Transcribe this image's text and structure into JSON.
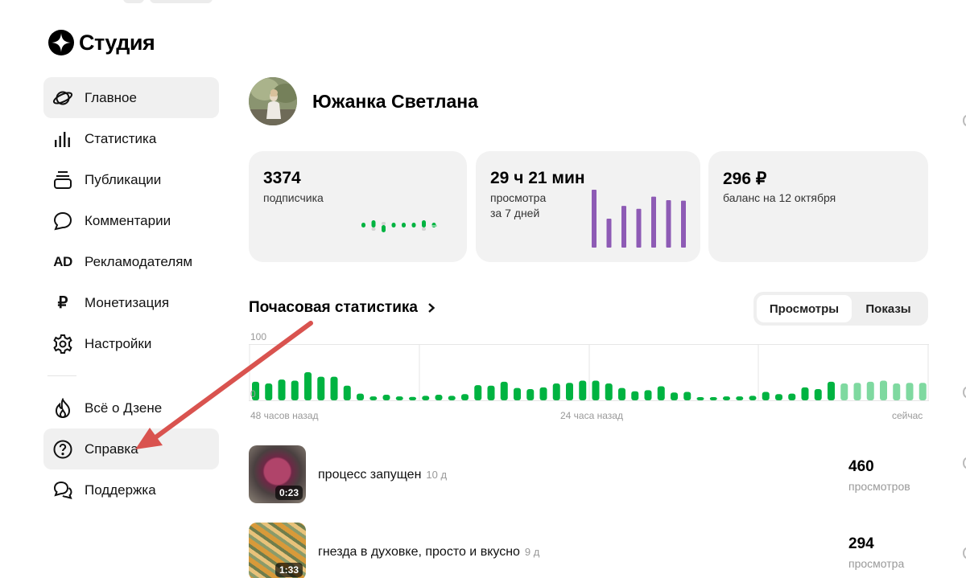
{
  "logo": {
    "text": "Студия"
  },
  "sidebar": {
    "items": [
      {
        "label": "Главное",
        "icon": "planet-icon",
        "active": true
      },
      {
        "label": "Статистика",
        "icon": "bar-chart-icon"
      },
      {
        "label": "Публикации",
        "icon": "publications-stack-icon"
      },
      {
        "label": "Комментарии",
        "icon": "speech-bubble-icon"
      },
      {
        "label": "Рекламодателям",
        "icon": "ad-icon"
      },
      {
        "label": "Монетизация",
        "icon": "ruble-icon"
      },
      {
        "label": "Настройки",
        "icon": "gear-icon"
      }
    ],
    "secondary": [
      {
        "label": "Всё о Дзене",
        "icon": "flame-icon"
      },
      {
        "label": "Справка",
        "icon": "help-circle-icon",
        "highlighted": true
      },
      {
        "label": "Поддержка",
        "icon": "chat-bubbles-icon"
      }
    ],
    "ad_glyph": "AD",
    "ruble_glyph": "₽"
  },
  "profile": {
    "name": "Южанка Светлана"
  },
  "stats": {
    "subscribers": {
      "value": "3374",
      "label": "подписчика"
    },
    "watch_time": {
      "value": "29 ч 21 мин",
      "label_line1": "просмотра",
      "label_line2": "за 7 дней"
    },
    "balance": {
      "value": "296 ₽",
      "label": "баланс на 12 октября"
    }
  },
  "hourly": {
    "title": "Почасовая статистика",
    "toggle": {
      "active": "Просмотры",
      "inactive": "Показы"
    },
    "y_max_label": "100",
    "y_min_label": "0",
    "x_labels": [
      "48 часов назад",
      "24 часа назад",
      "сейчас"
    ]
  },
  "publications": [
    {
      "title": "процесс запущен",
      "age": "10 д",
      "duration": "0:23",
      "views": "460",
      "views_label": "просмотров"
    },
    {
      "title": "гнезда в духовке, просто и вкусно",
      "age": "9 д",
      "duration": "1:33",
      "views": "294",
      "views_label": "просмотра"
    }
  ],
  "colors": {
    "accent_green": "#00b341",
    "light_green": "#7fd9a0",
    "purple": "#8e5bb5",
    "annotation_red": "#d9534f"
  },
  "chart_data": [
    {
      "type": "bar",
      "title": "Почасовая статистика",
      "ylim": [
        0,
        100
      ],
      "x_ticks": [
        "48 часов назад",
        "24 часа назад",
        "сейчас"
      ],
      "series": [
        {
          "name": "Просмотры",
          "values": [
            33,
            30,
            37,
            35,
            50,
            42,
            42,
            26,
            12,
            7,
            10,
            7,
            6,
            8,
            10,
            8,
            11,
            27,
            26,
            33,
            22,
            20,
            23,
            30,
            31,
            35,
            35,
            30,
            22,
            16,
            18,
            25,
            14,
            15,
            5,
            5,
            7,
            7,
            8,
            15,
            11,
            12,
            23,
            20,
            33,
            30,
            31,
            33,
            35,
            30,
            31,
            31
          ],
          "recent_hours": 7
        }
      ]
    },
    {
      "type": "bar",
      "title": "просмотра за 7 дней",
      "values": [
        100,
        50,
        72,
        67,
        88,
        82,
        81
      ],
      "ylim": [
        0,
        100
      ]
    },
    {
      "type": "line",
      "title": "подписчика",
      "values": [
        0,
        1,
        -1,
        0,
        0,
        0,
        1,
        0
      ],
      "note": "sparkline"
    }
  ]
}
